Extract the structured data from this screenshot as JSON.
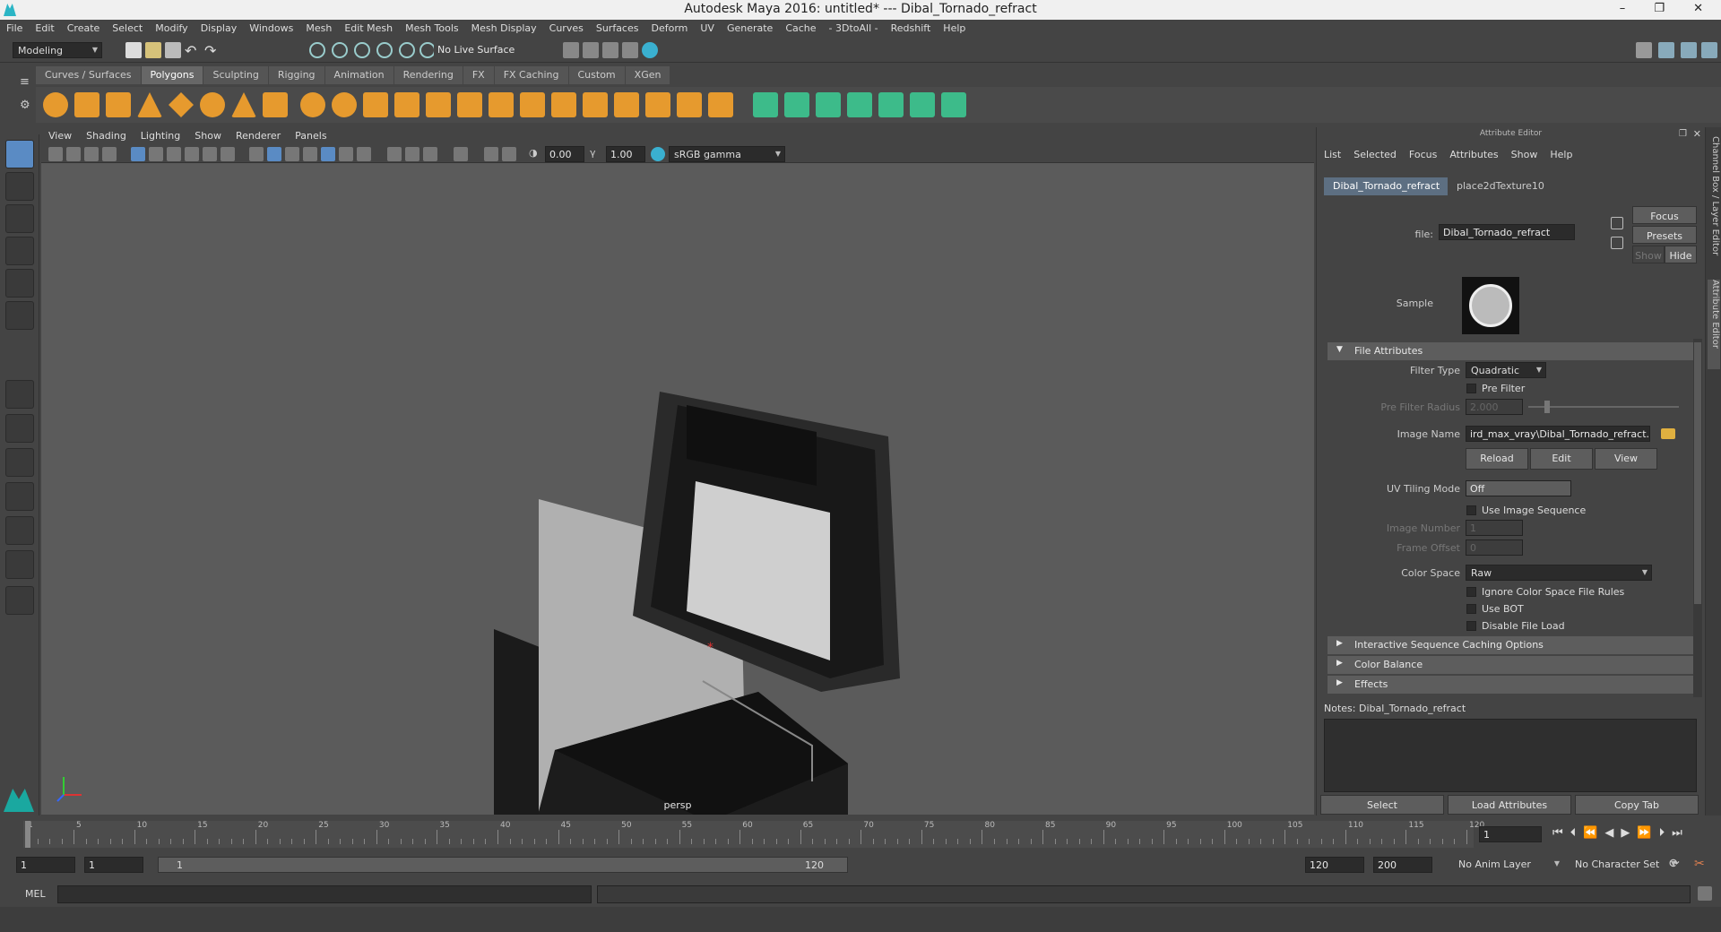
{
  "window": {
    "title": "Autodesk Maya 2016: untitled*    ---    Dibal_Tornado_refract",
    "controls": "–  ❐  ✕"
  },
  "menubar": [
    "File",
    "Edit",
    "Create",
    "Select",
    "Modify",
    "Display",
    "Windows",
    "Mesh",
    "Edit Mesh",
    "Mesh Tools",
    "Mesh Display",
    "Curves",
    "Surfaces",
    "Deform",
    "UV",
    "Generate",
    "Cache",
    "- 3DtoAll -",
    "Redshift",
    "Help"
  ],
  "status": {
    "mode": "Modeling",
    "live_surface": "No Live Surface"
  },
  "shelf_tabs": [
    {
      "label": "Curves / Surfaces",
      "active": false
    },
    {
      "label": "Polygons",
      "active": true
    },
    {
      "label": "Sculpting",
      "active": false
    },
    {
      "label": "Rigging",
      "active": false
    },
    {
      "label": "Animation",
      "active": false
    },
    {
      "label": "Rendering",
      "active": false
    },
    {
      "label": "FX",
      "active": false
    },
    {
      "label": "FX Caching",
      "active": false
    },
    {
      "label": "Custom",
      "active": false
    },
    {
      "label": "XGen",
      "active": false
    }
  ],
  "viewport": {
    "menu": [
      "View",
      "Shading",
      "Lighting",
      "Show",
      "Renderer",
      "Panels"
    ],
    "exposure": "0.00",
    "gamma": "1.00",
    "color_space": "sRGB gamma",
    "camera_label": "persp"
  },
  "attr_editor": {
    "header": "Attribute Editor",
    "menu": [
      "List",
      "Selected",
      "Focus",
      "Attributes",
      "Show",
      "Help"
    ],
    "tabs": [
      "Dibal_Tornado_refract",
      "place2dTexture10"
    ],
    "file_label": "file:",
    "file_value": "Dibal_Tornado_refract",
    "focus": "Focus",
    "presets": "Presets",
    "show": "Show",
    "hide": "Hide",
    "sample": "Sample",
    "section_file": "File Attributes",
    "filter_type_label": "Filter Type",
    "filter_type_value": "Quadratic",
    "pre_filter": "Pre Filter",
    "pre_filter_radius_label": "Pre Filter Radius",
    "pre_filter_radius_value": "2.000",
    "image_name_label": "Image Name",
    "image_name_value": "ird_max_vray\\Dibal_Tornado_refract.png",
    "reload": "Reload",
    "edit": "Edit",
    "view": "View",
    "uv_tiling_label": "UV Tiling Mode",
    "uv_tiling_value": "Off",
    "use_image_sequence": "Use Image Sequence",
    "image_number_label": "Image Number",
    "image_number_value": "1",
    "frame_offset_label": "Frame Offset",
    "frame_offset_value": "0",
    "color_space_label": "Color Space",
    "color_space_value": "Raw",
    "ignore_cs": "Ignore Color Space File Rules",
    "use_bot": "Use BOT",
    "disable_load": "Disable File Load",
    "sections": [
      "Interactive Sequence Caching Options",
      "Color Balance",
      "Effects"
    ],
    "notes": "Notes:  Dibal_Tornado_refract",
    "btn_select": "Select",
    "btn_load": "Load Attributes",
    "btn_copy": "Copy Tab"
  },
  "side_tabs": [
    "Channel Box / Layer Editor",
    "Attribute Editor"
  ],
  "timeline": {
    "labels": [
      "1",
      "5",
      "10",
      "15",
      "20",
      "25",
      "30",
      "35",
      "40",
      "45",
      "50",
      "55",
      "60",
      "65",
      "70",
      "75",
      "80",
      "85",
      "90",
      "95",
      "100",
      "105",
      "110",
      "115",
      "120"
    ],
    "current_frame": "1"
  },
  "range": {
    "start": "1",
    "playback_start": "1",
    "range_start": "1",
    "range_end": "120",
    "playback_end": "120",
    "end": "200",
    "anim_layer": "No Anim Layer",
    "char_set": "No Character Set"
  },
  "cmd": {
    "lang": "MEL"
  }
}
